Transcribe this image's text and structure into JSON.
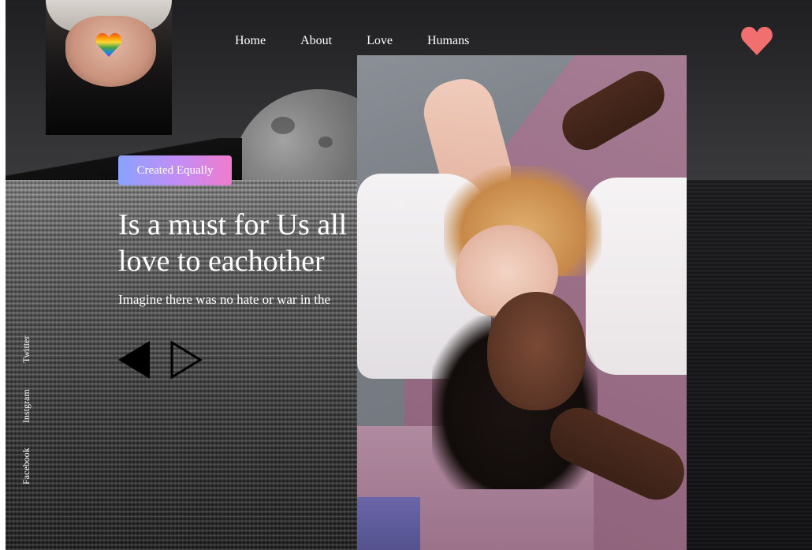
{
  "nav": {
    "items": [
      {
        "label": "Home"
      },
      {
        "label": "About"
      },
      {
        "label": "Love"
      },
      {
        "label": "Humans"
      }
    ]
  },
  "brand": {
    "icon": "heart-icon",
    "color": "#f26f6f"
  },
  "hero": {
    "badge": "Created Equally",
    "headline_line1": "Is a must for Us all",
    "headline_line2": "love to eachother",
    "subtitle": "Imagine there was no hate or war in the"
  },
  "slider": {
    "prev_icon": "triangle-left-filled-icon",
    "next_icon": "triangle-right-outline-icon"
  },
  "social": {
    "links": [
      {
        "label": "Twitter"
      },
      {
        "label": "Instgram"
      },
      {
        "label": "Facebook"
      }
    ]
  },
  "images": {
    "thumbnail": "hands-holding-rainbow-heart",
    "main_photo": "two-women-lying-on-blanket"
  },
  "colors": {
    "badge_gradient_start": "#8aa3ff",
    "badge_gradient_end": "#f07ccc",
    "heart": "#f26f6f",
    "text": "#ffffff"
  }
}
